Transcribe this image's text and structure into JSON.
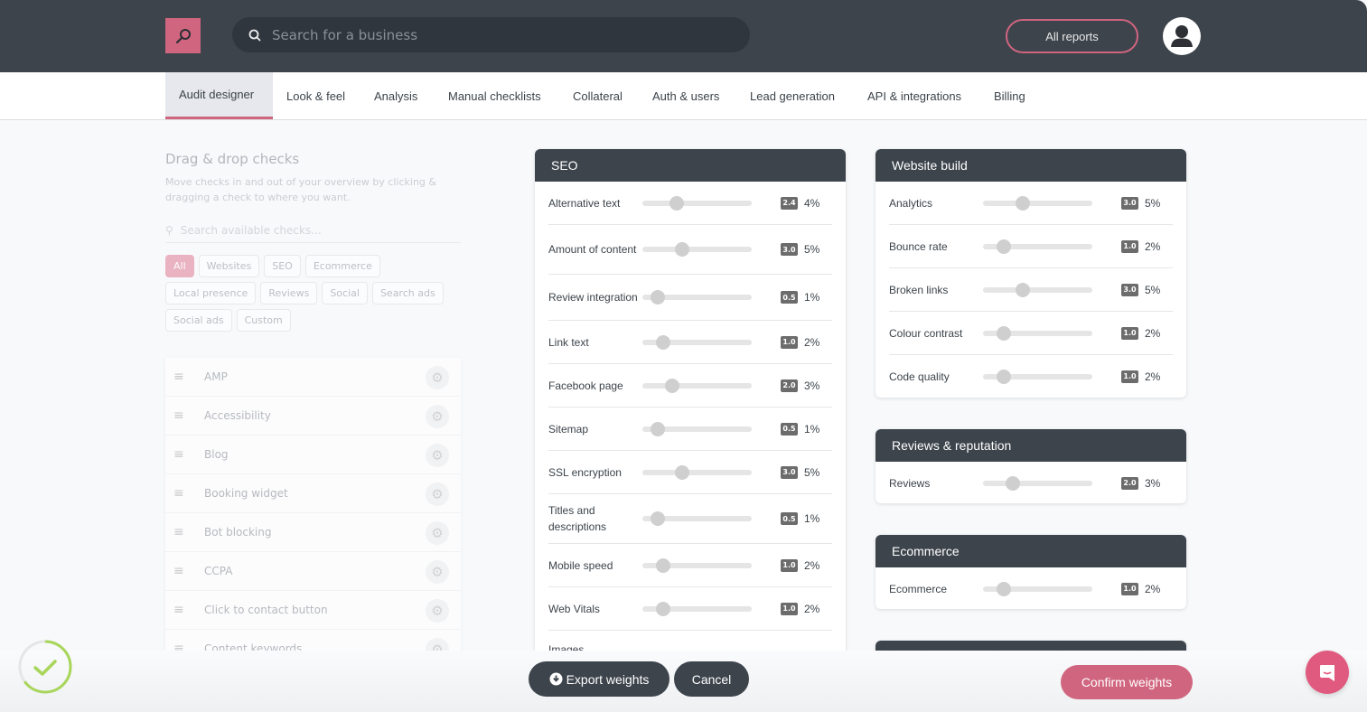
{
  "header": {
    "search_placeholder": "Search for a business",
    "all_reports_label": "All reports",
    "brand_color": "#d0657f"
  },
  "tabs": [
    {
      "label": "Audit designer",
      "active": true
    },
    {
      "label": "Look & feel"
    },
    {
      "label": "Analysis"
    },
    {
      "label": "Manual checklists"
    },
    {
      "label": "Collateral"
    },
    {
      "label": "Auth & users"
    },
    {
      "label": "Lead generation"
    },
    {
      "label": "API & integrations"
    },
    {
      "label": "Billing"
    }
  ],
  "left_panel": {
    "title": "Drag & drop checks",
    "description": "Move checks in and out of your overview by clicking & dragging a check to where you want.",
    "search_placeholder": "Search available checks...",
    "filters": [
      "All",
      "Websites",
      "SEO",
      "Ecommerce",
      "Local presence",
      "Reviews",
      "Social",
      "Search ads",
      "Social ads",
      "Custom"
    ],
    "active_filter": "All",
    "checks": [
      "AMP",
      "Accessibility",
      "Blog",
      "Booking widget",
      "Bot blocking",
      "CCPA",
      "Click to contact button",
      "Content keywords"
    ]
  },
  "slider_max": 10,
  "sections": {
    "seo": {
      "title": "SEO",
      "rows": [
        {
          "name": "Alternative text",
          "weight": "2.4",
          "value": 2.4,
          "percent": "4%"
        },
        {
          "name": "Amount of content",
          "weight": "3.0",
          "value": 3.0,
          "percent": "5%"
        },
        {
          "name": "Review integration",
          "weight": "0.5",
          "value": 0.5,
          "percent": "1%"
        },
        {
          "name": "Link text",
          "weight": "1.0",
          "value": 1.0,
          "percent": "2%"
        },
        {
          "name": "Facebook page",
          "weight": "2.0",
          "value": 2.0,
          "percent": "3%"
        },
        {
          "name": "Sitemap",
          "weight": "0.5",
          "value": 0.5,
          "percent": "1%"
        },
        {
          "name": "SSL encryption",
          "weight": "3.0",
          "value": 3.0,
          "percent": "5%"
        },
        {
          "name": "Titles and descriptions",
          "weight": "0.5",
          "value": 0.5,
          "percent": "1%"
        },
        {
          "name": "Mobile speed",
          "weight": "1.0",
          "value": 1.0,
          "percent": "2%"
        },
        {
          "name": "Web Vitals",
          "weight": "1.0",
          "value": 1.0,
          "percent": "2%"
        },
        {
          "name": "Images",
          "weight": "",
          "value": null,
          "percent": ""
        }
      ]
    },
    "website_build": {
      "title": "Website build",
      "rows": [
        {
          "name": "Analytics",
          "weight": "3.0",
          "value": 3.0,
          "percent": "5%"
        },
        {
          "name": "Bounce rate",
          "weight": "1.0",
          "value": 1.0,
          "percent": "2%"
        },
        {
          "name": "Broken links",
          "weight": "3.0",
          "value": 3.0,
          "percent": "5%"
        },
        {
          "name": "Colour contrast",
          "weight": "1.0",
          "value": 1.0,
          "percent": "2%"
        },
        {
          "name": "Code quality",
          "weight": "1.0",
          "value": 1.0,
          "percent": "2%"
        }
      ]
    },
    "reviews": {
      "title": "Reviews & reputation",
      "rows": [
        {
          "name": "Reviews",
          "weight": "2.0",
          "value": 2.0,
          "percent": "3%"
        }
      ]
    },
    "ecommerce": {
      "title": "Ecommerce",
      "rows": [
        {
          "name": "Ecommerce",
          "weight": "1.0",
          "value": 1.0,
          "percent": "2%"
        }
      ]
    }
  },
  "footer": {
    "export_label": "Export weights",
    "cancel_label": "Cancel",
    "confirm_label": "Confirm weights"
  },
  "status": {
    "progress": 0.65,
    "progress_color": "#a8d65a"
  }
}
